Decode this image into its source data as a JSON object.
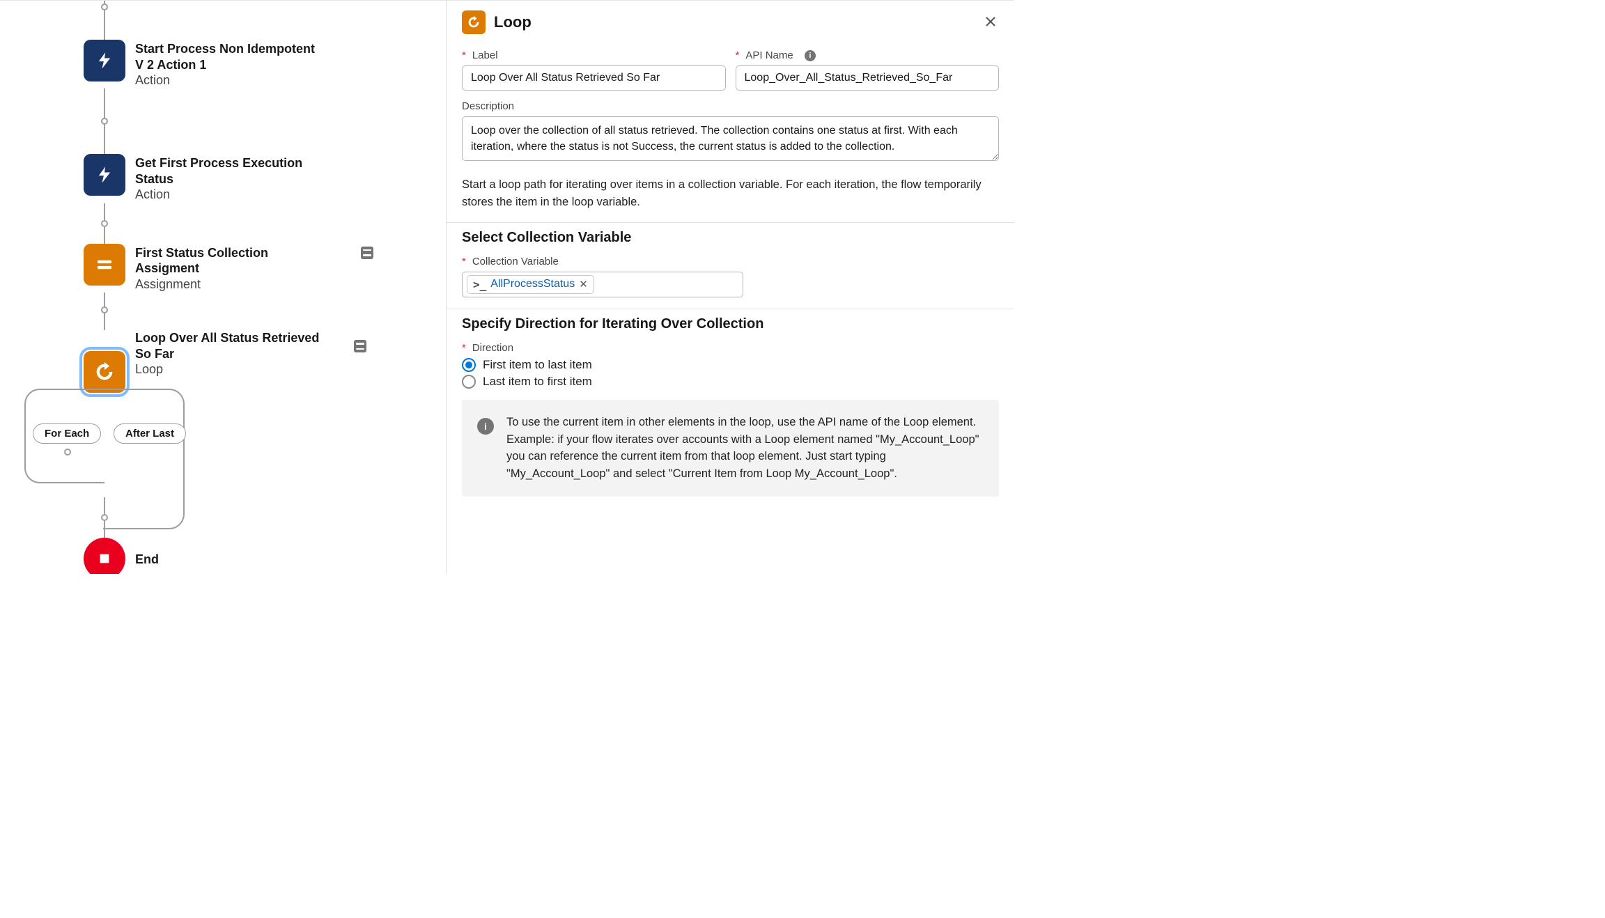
{
  "canvas": {
    "nodes": [
      {
        "title": "Start Process Non Idempotent V 2 Action 1",
        "type": "Action"
      },
      {
        "title": "Get First Process Execution Status",
        "type": "Action"
      },
      {
        "title": "First Status Collection Assigment",
        "type": "Assignment"
      },
      {
        "title": "Loop Over All Status Retrieved So Far",
        "type": "Loop"
      },
      {
        "title": "End",
        "type": ""
      }
    ],
    "branches": {
      "left": "For Each",
      "right": "After Last"
    }
  },
  "panel": {
    "title": "Loop",
    "fields": {
      "label_label": "Label",
      "label_value": "Loop Over All Status Retrieved So Far",
      "api_label": "API Name",
      "api_value": "Loop_Over_All_Status_Retrieved_So_Far",
      "desc_label": "Description",
      "desc_value": "Loop over the collection of all status retrieved. The collection contains one status at first. With each iteration, where the status is not Success, the current status is added to the collection."
    },
    "help": "Start a loop path for iterating over items in a collection variable. For each iteration, the flow temporarily stores the item in the loop variable.",
    "collection": {
      "heading": "Select Collection Variable",
      "label": "Collection Variable",
      "token": "AllProcessStatus"
    },
    "direction": {
      "heading": "Specify Direction for Iterating Over Collection",
      "label": "Direction",
      "opt1": "First item to last item",
      "opt2": "Last item to first item"
    },
    "callout": "To use the current item in other elements in the loop, use the API name of the Loop element. Example: if your flow iterates over accounts with a Loop element named \"My_Account_Loop\" you can reference the current item from that loop element. Just start typing \"My_Account_Loop\" and select \"Current Item from Loop My_Account_Loop\"."
  }
}
